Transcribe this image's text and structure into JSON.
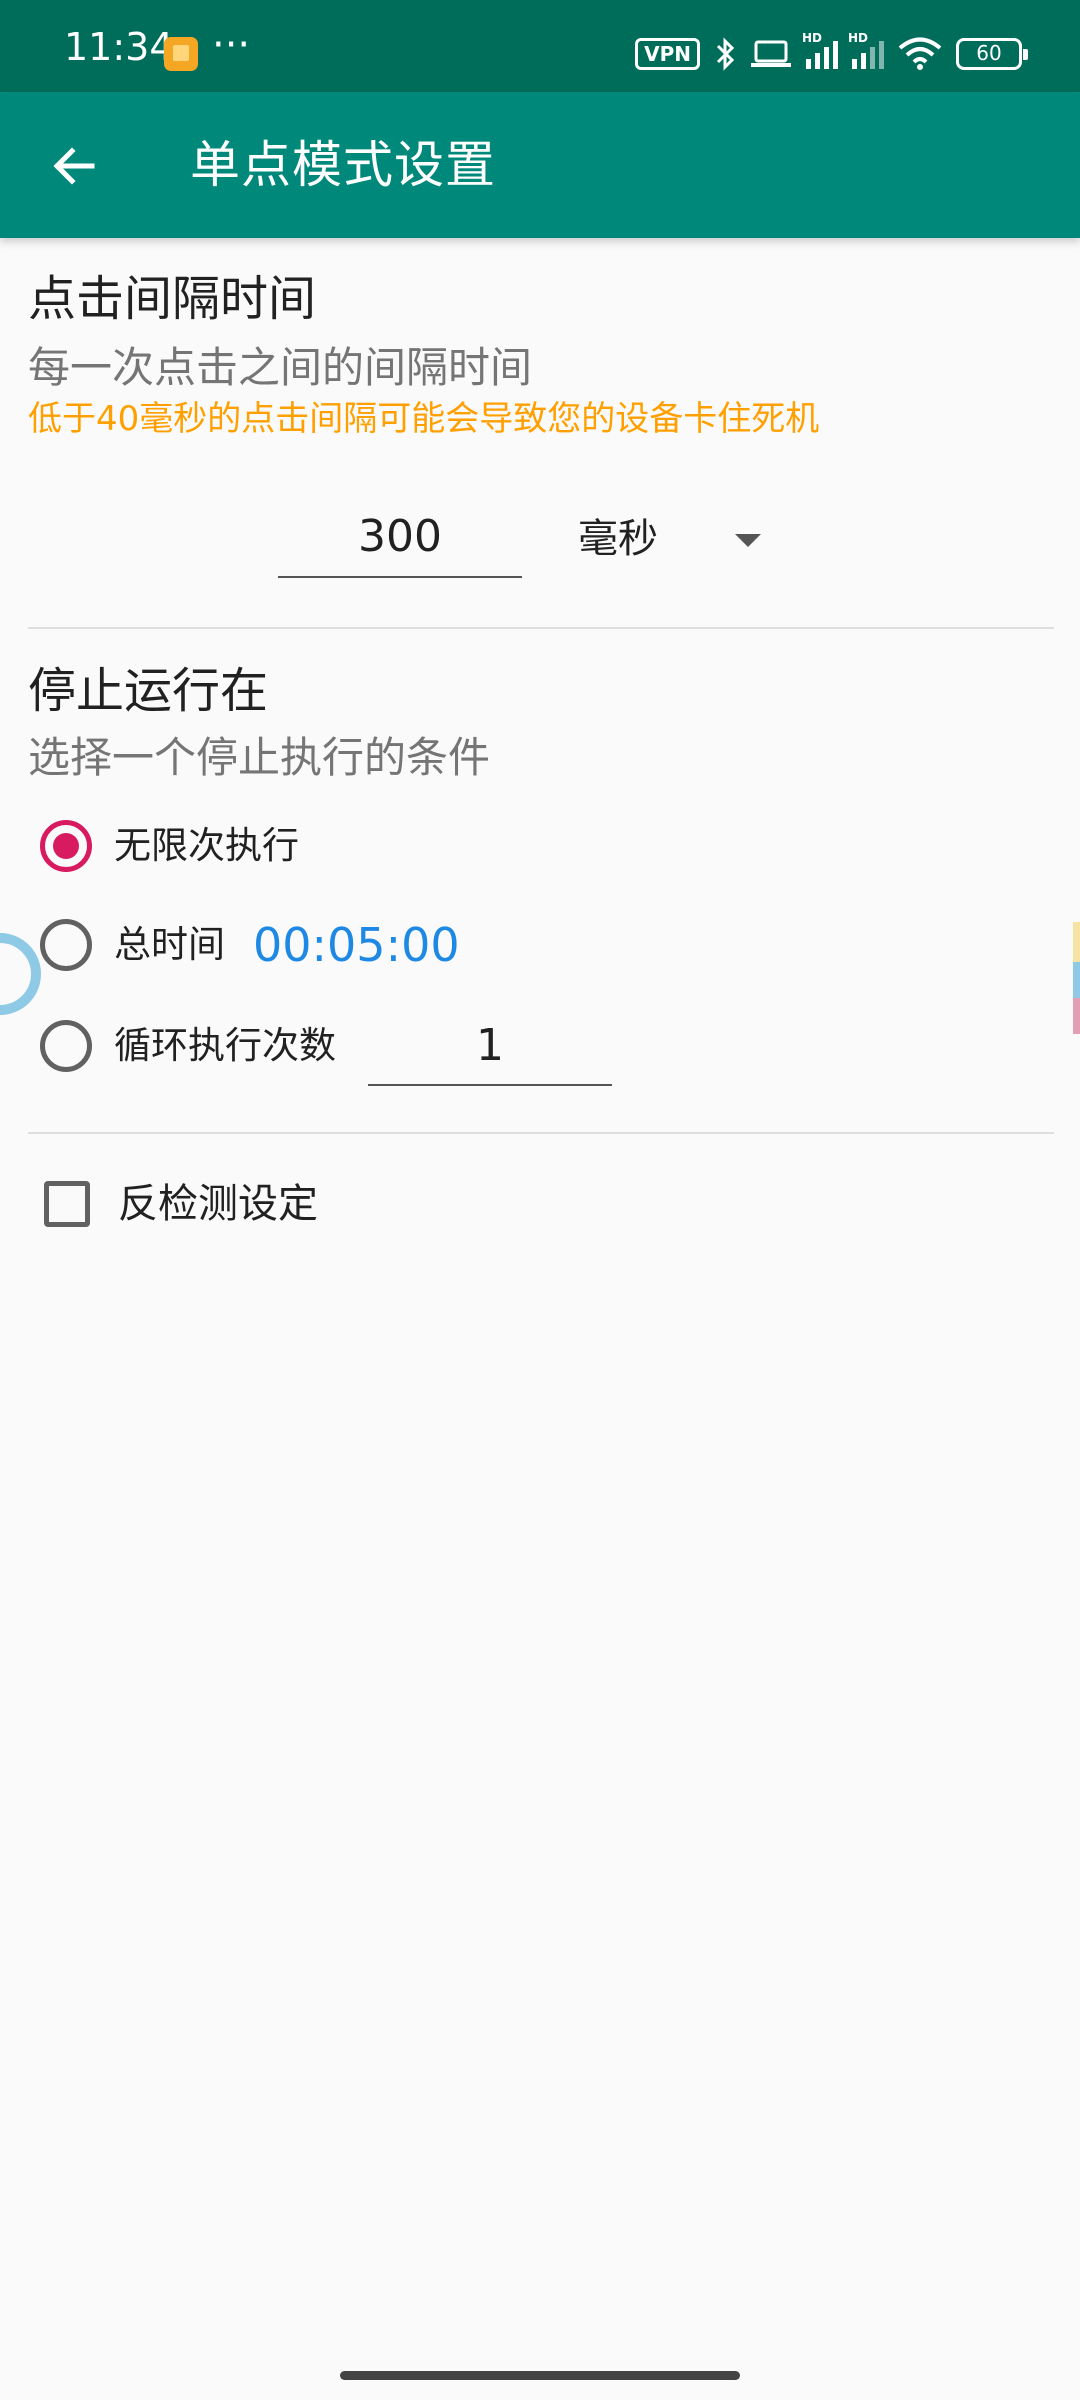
{
  "status_bar": {
    "time": "11:34",
    "more": "···",
    "vpn": "VPN",
    "hd": "HD",
    "battery": "60"
  },
  "app_bar": {
    "title": "单点模式设置"
  },
  "click_interval": {
    "title": "点击间隔时间",
    "subtitle": "每一次点击之间的间隔时间",
    "warning": "低于40毫秒的点击间隔可能会导致您的设备卡住死机",
    "value": "300",
    "unit": "毫秒"
  },
  "stop_condition": {
    "title": "停止运行在",
    "subtitle": "选择一个停止执行的条件",
    "options": [
      {
        "label": "无限次执行",
        "selected": true
      },
      {
        "label": "总时间",
        "value": "00:05:00",
        "selected": false
      },
      {
        "label": "循环执行次数",
        "value": "1",
        "selected": false
      }
    ]
  },
  "anti_detect": {
    "label": "反检测设定",
    "checked": false
  },
  "colors": {
    "status_bar": "#006d5b",
    "app_bar": "#00897b",
    "radio_accent": "#d81b60",
    "warning": "#ffa000",
    "time_value": "#1e88e5"
  }
}
